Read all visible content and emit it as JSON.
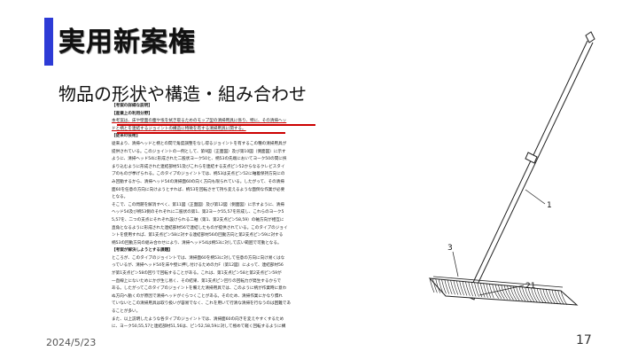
{
  "slide": {
    "title": "実用新案権",
    "subtitle": "物品の形状や構造・組み合わせ",
    "date": "2024/5/23",
    "page_number": "17",
    "accent_color": "#2d3bd6"
  },
  "document": {
    "lines": [
      {
        "text": "【考案の詳細な説明】",
        "cls": "sec"
      },
      {
        "text": "【産業上の利用分野】",
        "cls": "sec"
      },
      {
        "text": "本考案は、床や壁面の塵や埃を拭き取るためのモップ型の清掃用具に係り、特に、その清掃ヘッ",
        "cls": "ul"
      },
      {
        "text": "ドと柄とを連結するジョイントの構造に特徴を有する清掃用具に関する。",
        "cls": "ul"
      },
      {
        "text": "【従来の技術】",
        "cls": "sec"
      },
      {
        "text": "従来より、清掃ヘッドと柄との間で角度調整をなし得るジョイントを有するこの種の清掃用具が",
        "cls": ""
      },
      {
        "text": "提供されている。このジョイントの一例として、第9図（正面図）及び第10図（側面図）に示す",
        "cls": ""
      },
      {
        "text": "ように、清掃ヘッド54に形成された二股状ヨーク50と、柄53の先端においてヨーク50の間に挟",
        "cls": ""
      },
      {
        "text": "まり込むように形成された連結部材51及びこれらを連結する支点ピン52からなるクレビスタイ",
        "cls": ""
      },
      {
        "text": "プのものが挙げられる。このタイプのジョイントでは、柄53は支点ピン52に軸着保持方向にの",
        "cls": ""
      },
      {
        "text": "み回動するから、清掃ヘッド54の清掃面60の向く方向も限られている。したがって、その清掃",
        "cls": ""
      },
      {
        "text": "面60を任意の方向に向けようとすれば、柄53を回転させて持ち変えるような面倒な作業が必要",
        "cls": ""
      },
      {
        "text": "となる。",
        "cls": ""
      },
      {
        "text": "そこで、この問題を解消すべく、第11図（正面図）及び第12図（側面図）に示すように、清掃",
        "cls": ""
      },
      {
        "text": "ヘッド54及び柄53側のそれぞれに二股状の第1、第2ヨーク55,57を形成し、これらのヨーク5",
        "cls": ""
      },
      {
        "text": "5,57を、二つの支点にそれぞれ設けられる二軸（第1、第2支点ピン58,59）の軸方向が相互に",
        "cls": ""
      },
      {
        "text": "直角となるように形成された連結部材56で連結したものが提供されている。このタイプのジョイ",
        "cls": ""
      },
      {
        "text": "ントを使用すれば、第1支点ピン58に対する連結部材56の回動方向と第2支点ピン59に対する",
        "cls": ""
      },
      {
        "text": "柄53の回動方向の組み合わせにより、清掃ヘッド54は柄53に対して広い範囲で可動となる。",
        "cls": ""
      },
      {
        "text": "【考案が解決しようとする課題】",
        "cls": "sec"
      },
      {
        "text": "ところが、このタイプのジョイントでは、清掃面60を柄53に対して任意の方向に向け易くはな",
        "cls": ""
      },
      {
        "text": "っているが、清掃ヘッド54を床や壁に押し付けるための力F（第12図）によって、連結部材56",
        "cls": ""
      },
      {
        "text": "が第1支点ピン58の回りで回転することがある。これは、第1支点ピン58と第2支点ピン59が",
        "cls": ""
      },
      {
        "text": "一直線上にないためにかが生じ易く、その結果、第1支点ピン回りの回転力が発生するからで",
        "cls": ""
      },
      {
        "text": "ある。したがってこのタイプのジョイントを備えた清掃用具では、このように柄が作業時に意わ",
        "cls": ""
      },
      {
        "text": "ぬ方向へ動くのが原因で清掃ヘッドがぐらつくことがある。そのため、清掃作業にかなり慣れ",
        "cls": ""
      },
      {
        "text": "ていないとこの清掃用具は取り扱いが容易でなく、これを用いて行清な清掃を行なうのは困難であ",
        "cls": ""
      },
      {
        "text": "ることが多い。",
        "cls": ""
      },
      {
        "text": "また、以上説明したような各タイプのジョイントでは、清掃面60の向きを変えやすくするため",
        "cls": ""
      },
      {
        "text": "に、ヨーク50,55,57と連結部材51,56は、ピン52,58,59に対して極めて軽く回転するように構",
        "cls": ""
      }
    ]
  },
  "figure": {
    "labels": [
      "1",
      "3",
      "21"
    ]
  }
}
